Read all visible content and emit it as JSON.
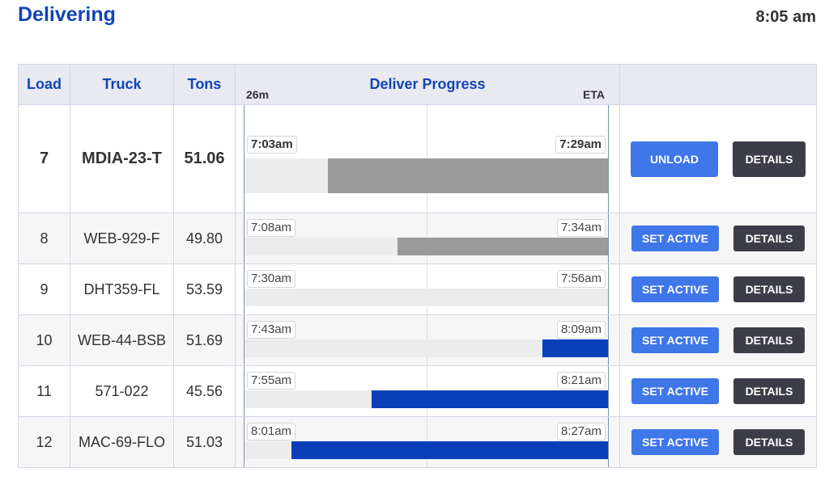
{
  "header": {
    "title": "Delivering",
    "clock": "8:05 am"
  },
  "table": {
    "columns": {
      "load": "Load",
      "truck": "Truck",
      "tons": "Tons",
      "progress": "Deliver Progress",
      "progress_left": "26m",
      "progress_right": "ETA",
      "actions": ""
    },
    "rows": [
      {
        "load": "7",
        "truck": "MDIA-23-T",
        "tons": "51.06",
        "start": "7:03am",
        "eta": "7:29am",
        "progress_fraction": 0.77,
        "bar_color": "#9a9a9a",
        "primary_action": "UNLOAD",
        "secondary_action": "DETAILS"
      },
      {
        "load": "8",
        "truck": "WEB-929-F",
        "tons": "49.80",
        "start": "7:08am",
        "eta": "7:34am",
        "progress_fraction": 0.58,
        "bar_color": "#9a9a9a",
        "primary_action": "SET ACTIVE",
        "secondary_action": "DETAILS"
      },
      {
        "load": "9",
        "truck": "DHT359-FL",
        "tons": "53.59",
        "start": "7:30am",
        "eta": "7:56am",
        "progress_fraction": 0.0,
        "bar_color": "#9a9a9a",
        "primary_action": "SET ACTIVE",
        "secondary_action": "DETAILS"
      },
      {
        "load": "10",
        "truck": "WEB-44-BSB",
        "tons": "51.69",
        "start": "7:43am",
        "eta": "8:09am",
        "progress_fraction": 0.18,
        "bar_color": "#0b3fb9",
        "primary_action": "SET ACTIVE",
        "secondary_action": "DETAILS"
      },
      {
        "load": "11",
        "truck": "571-022",
        "tons": "45.56",
        "start": "7:55am",
        "eta": "8:21am",
        "progress_fraction": 0.65,
        "bar_color": "#0b3fb9",
        "primary_action": "SET ACTIVE",
        "secondary_action": "DETAILS"
      },
      {
        "load": "12",
        "truck": "MAC-69-FLO",
        "tons": "51.03",
        "start": "8:01am",
        "eta": "8:27am",
        "progress_fraction": 0.87,
        "bar_color": "#0b3fb9",
        "primary_action": "SET ACTIVE",
        "secondary_action": "DETAILS"
      }
    ]
  },
  "colors": {
    "accent": "#1144b8",
    "primary_button": "#3f76e8",
    "dark_button": "#3d3d4a"
  }
}
